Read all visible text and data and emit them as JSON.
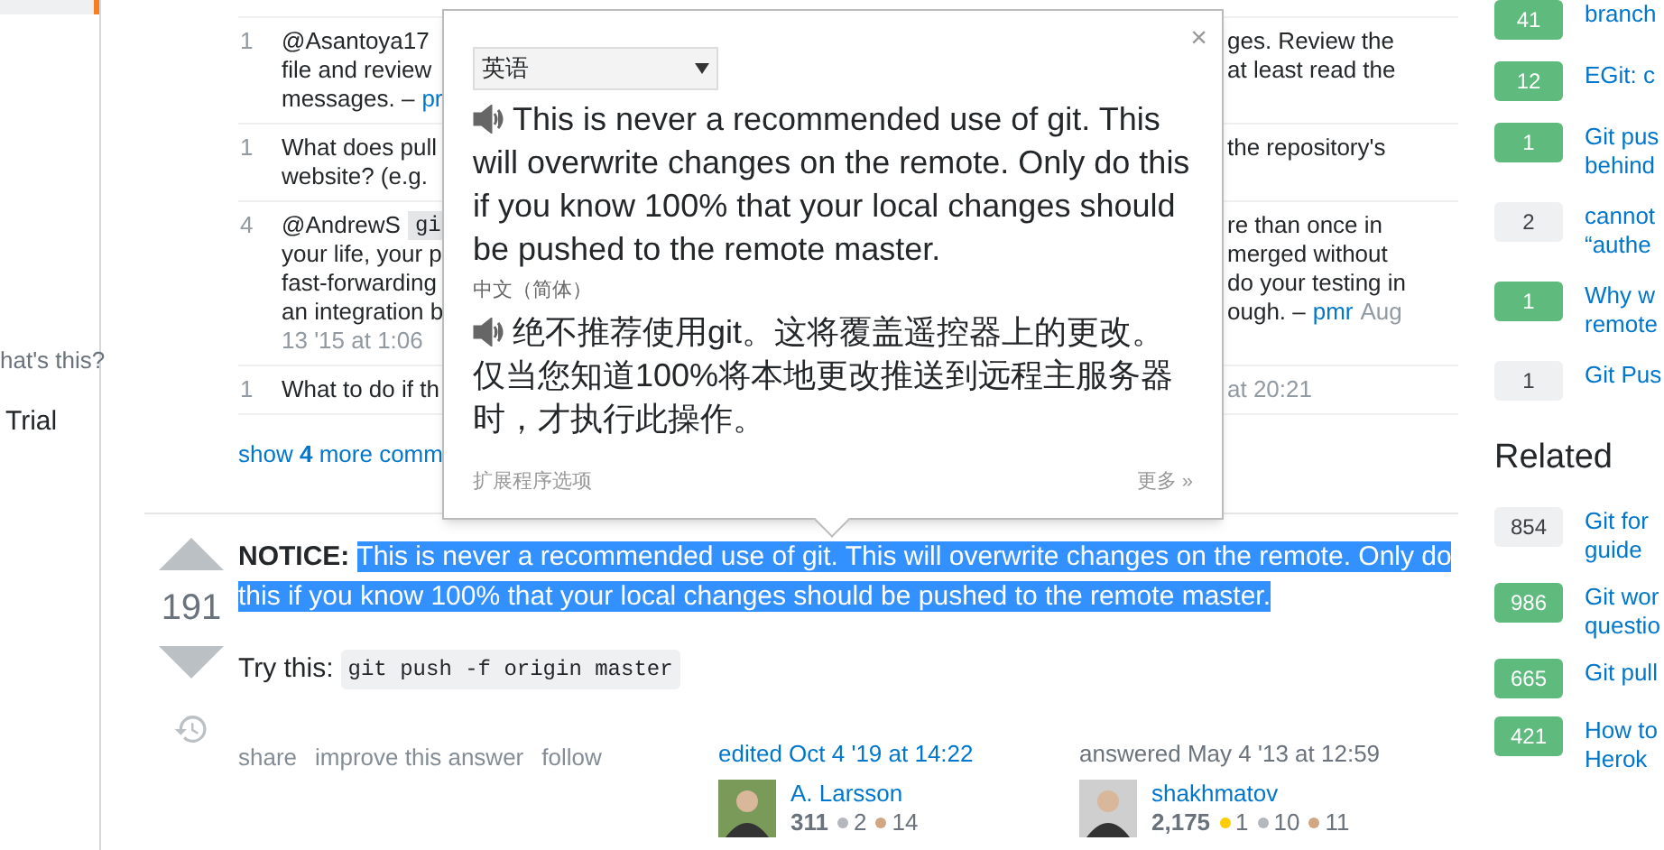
{
  "left_sidebar": {
    "items": [
      "hat's this?",
      "Trial"
    ]
  },
  "comments": [
    {
      "score": "1",
      "lines": [
        {
          "left": [
            {
              "kind": "text",
              "text": "@Asantoya17"
            }
          ],
          "right": [
            {
              "kind": "text",
              "text": "ges. Review the"
            }
          ]
        },
        {
          "left": [
            {
              "kind": "text",
              "text": "file and review"
            }
          ],
          "right": [
            {
              "kind": "text",
              "text": "at least read the"
            }
          ]
        },
        {
          "left": [
            {
              "kind": "text",
              "text": "messages. –"
            },
            {
              "kind": "link",
              "text": "pr"
            }
          ]
        }
      ]
    },
    {
      "score": "1",
      "lines": [
        {
          "left": [
            {
              "kind": "text",
              "text": "What does pull"
            }
          ],
          "right": [
            {
              "kind": "text",
              "text": "the repository's"
            }
          ]
        },
        {
          "left": [
            {
              "kind": "text",
              "text": "website? (e.g."
            }
          ]
        }
      ]
    },
    {
      "score": "4",
      "lines": [
        {
          "left": [
            {
              "kind": "text",
              "text": "@AndrewS"
            },
            {
              "kind": "code",
              "text": "gi"
            }
          ],
          "right": [
            {
              "kind": "text",
              "text": "re than once in"
            }
          ]
        },
        {
          "left": [
            {
              "kind": "text",
              "text": "your life, your p"
            }
          ],
          "right": [
            {
              "kind": "text",
              "text": "merged without"
            }
          ]
        },
        {
          "left": [
            {
              "kind": "text",
              "text": "fast-forwarding"
            }
          ],
          "right": [
            {
              "kind": "text",
              "text": "do your testing in"
            }
          ]
        },
        {
          "left": [
            {
              "kind": "text",
              "text": "an integration b"
            }
          ],
          "right": [
            {
              "kind": "text",
              "text": "ough. –"
            },
            {
              "kind": "link",
              "text": "pmr"
            },
            {
              "kind": "date",
              "text": "Aug"
            }
          ]
        },
        {
          "left": [
            {
              "kind": "date",
              "text": "13 '15 at 1:06"
            }
          ]
        }
      ]
    },
    {
      "score": "1",
      "lines": [
        {
          "left": [
            {
              "kind": "text",
              "text": "What to do if th"
            }
          ],
          "right": [
            {
              "kind": "date",
              "text": "at 20:21"
            }
          ]
        }
      ]
    }
  ],
  "show_more": {
    "prefix": "show",
    "count": "4",
    "suffix": "more comm"
  },
  "popup": {
    "close": "×",
    "language": "英语",
    "source_text": "This is never a recommended use of git. This will overwrite changes on the remote. Only do this if you know 100% that your local changes should be pushed to the remote master.",
    "target_language": "中文（简体）",
    "translated_text": "绝不推荐使用git。这将覆盖遥控器上的更改。仅当您知道100%将本地更改推送到远程主服务器时，才执行此操作。",
    "options_link": "扩展程序选项",
    "more_link": "更多 »"
  },
  "answer": {
    "votes": "191",
    "notice_label": "NOTICE:",
    "notice_text": "This is never a recommended use of git. This will overwrite changes on the remote. Only do this if you know 100% that your local changes should be pushed to the remote master.",
    "notice_selected": true,
    "try_label": "Try this:",
    "command": "git push -f origin master",
    "actions": [
      "share",
      "improve this answer",
      "follow"
    ],
    "cards": [
      {
        "kind": "edited",
        "action": "edited Oct 4 '19 at 14:22",
        "name": "A. Larsson",
        "rep": "311",
        "badges": [
          {
            "color": "#b4b8bc",
            "count": "2"
          },
          {
            "color": "#d1a684",
            "count": "14"
          }
        ]
      },
      {
        "kind": "answered",
        "action": "answered May 4 '13 at 12:59",
        "name": "shakhmatov",
        "rep": "2,175",
        "badges": [
          {
            "color": "#ffcc01",
            "count": "1"
          },
          {
            "color": "#b4b8bc",
            "count": "10"
          },
          {
            "color": "#d1a684",
            "count": "11"
          }
        ]
      }
    ]
  },
  "linked": [
    {
      "score": "41",
      "accepted": true,
      "lines": [
        "branch"
      ]
    },
    {
      "score": "12",
      "accepted": true,
      "lines": [
        "EGit: c"
      ]
    },
    {
      "score": "1",
      "accepted": true,
      "lines": [
        "Git pus",
        "behind"
      ]
    },
    {
      "score": "2",
      "accepted": false,
      "lines": [
        "cannot",
        "“authe"
      ]
    },
    {
      "score": "1",
      "accepted": true,
      "lines": [
        "Why w",
        "remote"
      ]
    },
    {
      "score": "1",
      "accepted": false,
      "lines": [
        "Git Pus"
      ]
    }
  ],
  "related": {
    "title": "Related",
    "items": [
      {
        "score": "854",
        "accepted": false,
        "lines": [
          "Git for",
          "guide"
        ]
      },
      {
        "score": "986",
        "accepted": true,
        "lines": [
          "Git wor",
          "questio"
        ]
      },
      {
        "score": "665",
        "accepted": true,
        "lines": [
          "Git pull"
        ]
      },
      {
        "score": "421",
        "accepted": true,
        "lines": [
          "How to",
          "Herok"
        ]
      }
    ]
  }
}
